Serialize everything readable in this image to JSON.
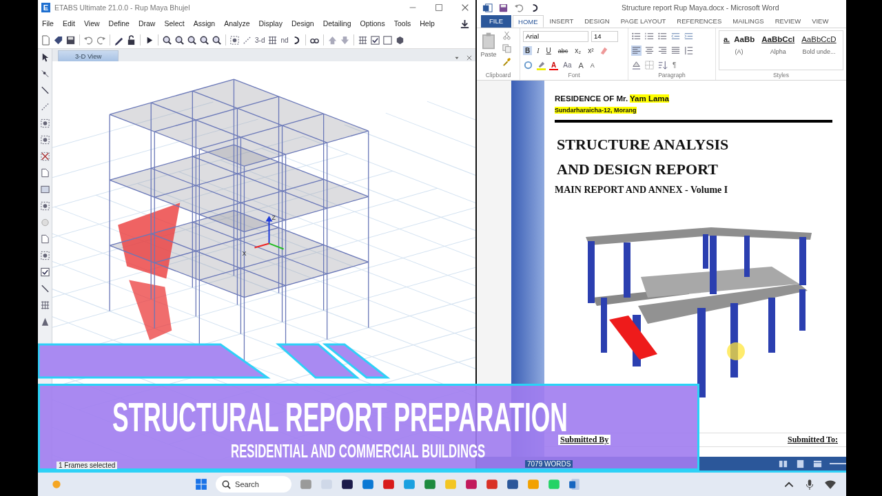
{
  "etabs": {
    "logo": "E",
    "title": "ETABS Ultimate 21.0.0 - Rup Maya Bhujel",
    "menu": [
      "File",
      "Edit",
      "View",
      "Define",
      "Draw",
      "Select",
      "Assign",
      "Analyze",
      "Display",
      "Design",
      "Detailing",
      "Options",
      "Tools",
      "Help"
    ],
    "toolbar_labels": [
      "3-d",
      "nd"
    ],
    "tabs": [
      {
        "label": "3-D View",
        "selected": true
      }
    ],
    "axes": [
      "Z",
      "X"
    ],
    "status": "1 Frames selected"
  },
  "word": {
    "title": "Structure report Rup Maya.docx - Microsoft Word",
    "tabs": [
      {
        "label": "FILE",
        "kind": "file",
        "selected": false
      },
      {
        "label": "HOME",
        "kind": "tab",
        "selected": true
      },
      {
        "label": "INSERT",
        "kind": "tab",
        "selected": false
      },
      {
        "label": "DESIGN",
        "kind": "tab",
        "selected": false
      },
      {
        "label": "PAGE LAYOUT",
        "kind": "tab",
        "selected": false
      },
      {
        "label": "REFERENCES",
        "kind": "tab",
        "selected": false
      },
      {
        "label": "MAILINGS",
        "kind": "tab",
        "selected": false
      },
      {
        "label": "REVIEW",
        "kind": "tab",
        "selected": false
      },
      {
        "label": "VIEW",
        "kind": "tab",
        "selected": false
      }
    ],
    "paste": "Paste",
    "font": {
      "name": "Arial",
      "size": "14"
    },
    "format": [
      {
        "label": "B",
        "selected": true
      },
      {
        "label": "I",
        "selected": false
      },
      {
        "label": "U",
        "selected": false
      },
      {
        "label": "abc",
        "selected": false
      },
      {
        "label": "x₂",
        "selected": false
      },
      {
        "label": "x²",
        "selected": false
      }
    ],
    "font_color": "A",
    "change_case": "Aa",
    "grow_shrink": [
      "A",
      "A"
    ],
    "pilcrow": "¶",
    "styles": [
      {
        "marker": "a.",
        "preview": "AaBb",
        "label": "(A)",
        "kind": "bold"
      },
      {
        "preview": "AaBbCcI",
        "label": "Alpha",
        "kind": "bold-underline"
      },
      {
        "preview": "AaBbCcD",
        "label": "Bold unde...",
        "kind": "underline"
      }
    ],
    "groups": [
      "Clipboard",
      "Font",
      "Paragraph",
      "Styles"
    ],
    "document": {
      "header": [
        {
          "text": "RESIDENCE OF Mr. ",
          "highlight": false
        },
        {
          "text": "Yam Lama",
          "highlight": true
        }
      ],
      "address": {
        "text": "Sundarharaicha-12, Morang",
        "highlight": true
      },
      "title_lines": [
        "STRUCTURE ANALYSIS",
        "AND DESIGN REPORT"
      ],
      "subtitle": "MAIN REPORT AND ANNEX - Volume I",
      "submitted_by": "Submitted By",
      "submitted_to": "Submitted To:"
    },
    "status": "7079 WORDS"
  },
  "banner": {
    "title": "STRUCTURAL REPORT PREPARATION",
    "subtitle": "RESIDENTIAL AND COMMERCIAL BUILDINGS"
  },
  "taskbar": {
    "search": {
      "placeholder": "Search"
    }
  }
}
